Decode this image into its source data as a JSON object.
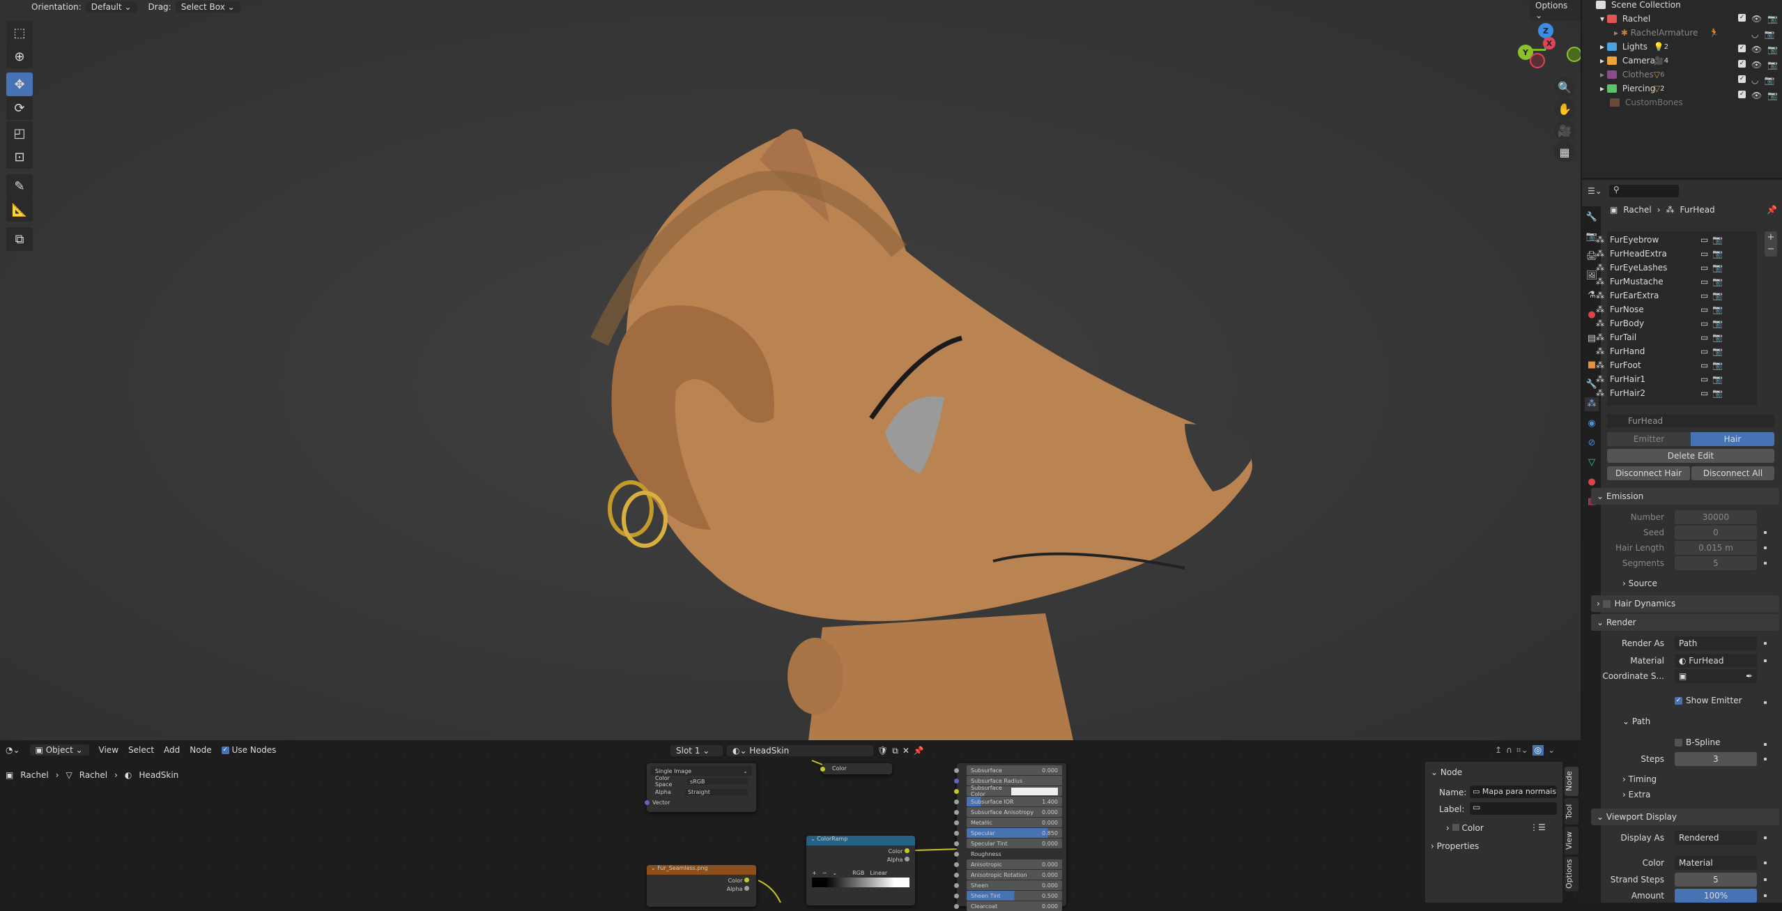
{
  "viewport": {
    "header": {
      "orientation_label": "Orientation:",
      "orientation_value": "Default",
      "drag_label": "Drag:",
      "drag_value": "Select Box",
      "options": "Options"
    },
    "tools": [
      "select-box",
      "cursor",
      "move",
      "rotate",
      "scale",
      "transform",
      "annotate",
      "measure",
      "add-cube"
    ],
    "gizmo": {
      "z": "Z",
      "x": "X",
      "y": "Y"
    }
  },
  "outliner": {
    "root": "Scene Collection",
    "items": [
      {
        "name": "Rachel",
        "color": "#e05656",
        "count": ""
      },
      {
        "name": "RachelArmature",
        "color": "#c8803a",
        "count": ""
      },
      {
        "name": "Lights",
        "color": "#4aa3df",
        "count": "2"
      },
      {
        "name": "Camera",
        "color": "#f0a23a",
        "count": "4"
      },
      {
        "name": "Clothes",
        "color": "#8a4d8a",
        "count": "6"
      },
      {
        "name": "Piercing",
        "color": "#5ec46a",
        "count": "2"
      },
      {
        "name": "CustomBones",
        "color": "#6b4a3a",
        "count": ""
      }
    ]
  },
  "properties": {
    "breadcrumb": {
      "object": "Rachel",
      "system": "FurHead"
    },
    "particle_systems": [
      "FurEyebrow",
      "FurHeadExtra",
      "FurEyeLashes",
      "FurMustache",
      "FurEarExtra",
      "FurNose",
      "FurBody",
      "FurTail",
      "FurHand",
      "FurFoot",
      "FurHair1",
      "FurHair2"
    ],
    "settings_name": "FurHead",
    "type_tabs": [
      "Emitter",
      "Hair"
    ],
    "active_type": "Hair",
    "delete_edit": "Delete Edit",
    "disconnect_hair": "Disconnect Hair",
    "disconnect_all": "Disconnect All",
    "emission": {
      "title": "Emission",
      "number_label": "Number",
      "number": "30000",
      "seed_label": "Seed",
      "seed": "0",
      "hair_length_label": "Hair Length",
      "hair_length": "0.015 m",
      "segments_label": "Segments",
      "segments": "5",
      "source": "Source"
    },
    "hair_dynamics": "Hair Dynamics",
    "render": {
      "title": "Render",
      "render_as_label": "Render As",
      "render_as": "Path",
      "material_label": "Material",
      "material": "FurHead",
      "coord_label": "Coordinate S...",
      "show_emitter": "Show Emitter",
      "show_emitter_checked": true,
      "path": "Path",
      "bspline": "B-Spline",
      "steps_label": "Steps",
      "steps": "3",
      "timing": "Timing",
      "extra": "Extra"
    },
    "viewport_display": {
      "title": "Viewport Display",
      "display_as_label": "Display As",
      "display_as": "Rendered",
      "color_label": "Color",
      "color": "Material",
      "strand_steps_label": "Strand Steps",
      "strand_steps": "5",
      "amount_label": "Amount",
      "amount": "100%"
    }
  },
  "node_editor": {
    "header": {
      "object_mode": "Object",
      "menus": [
        "View",
        "Select",
        "Add",
        "Node"
      ],
      "use_nodes": "Use Nodes",
      "slot": "Slot 1",
      "material": "HeadSkin"
    },
    "breadcrumb": [
      "Rachel",
      "Rachel",
      "HeadSkin"
    ],
    "image_node": {
      "source": "Single Image",
      "color_space_label": "Color Space",
      "color_space": "sRGB",
      "alpha_label": "Alpha",
      "alpha": "Straight",
      "vector": "Vector"
    },
    "partial_node_output": "Color",
    "fur_node": {
      "title": "Fur_Seamless.png",
      "color": "Color",
      "alpha": "Alpha"
    },
    "colorramp": {
      "title": "ColorRamp",
      "color": "Color",
      "alpha": "Alpha",
      "mode": "RGB",
      "interp": "Linear"
    },
    "bsdf": [
      {
        "l": "Subsurface",
        "v": "0.000"
      },
      {
        "l": "Subsurface Radius",
        "v": ""
      },
      {
        "l": "Subsurface Color",
        "v": ""
      },
      {
        "l": "Subsurface IOR",
        "v": "1.400"
      },
      {
        "l": "Subsurface Anisotropy",
        "v": "0.000"
      },
      {
        "l": "Metallic",
        "v": "0.000"
      },
      {
        "l": "Specular",
        "v": "0.850"
      },
      {
        "l": "Specular Tint",
        "v": "0.000"
      },
      {
        "l": "Roughness",
        "v": ""
      },
      {
        "l": "Anisotropic",
        "v": "0.000"
      },
      {
        "l": "Anisotropic Rotation",
        "v": "0.000"
      },
      {
        "l": "Sheen",
        "v": "0.000"
      },
      {
        "l": "Sheen Tint",
        "v": "0.500"
      },
      {
        "l": "Clearcoat",
        "v": "0.000"
      }
    ],
    "sidebar": {
      "node_title": "Node",
      "name_label": "Name:",
      "name": "Mapa para normais",
      "label_label": "Label:",
      "color": "Color",
      "properties": "Properties",
      "tabs": [
        "Node",
        "Tool",
        "View",
        "Options"
      ]
    }
  }
}
